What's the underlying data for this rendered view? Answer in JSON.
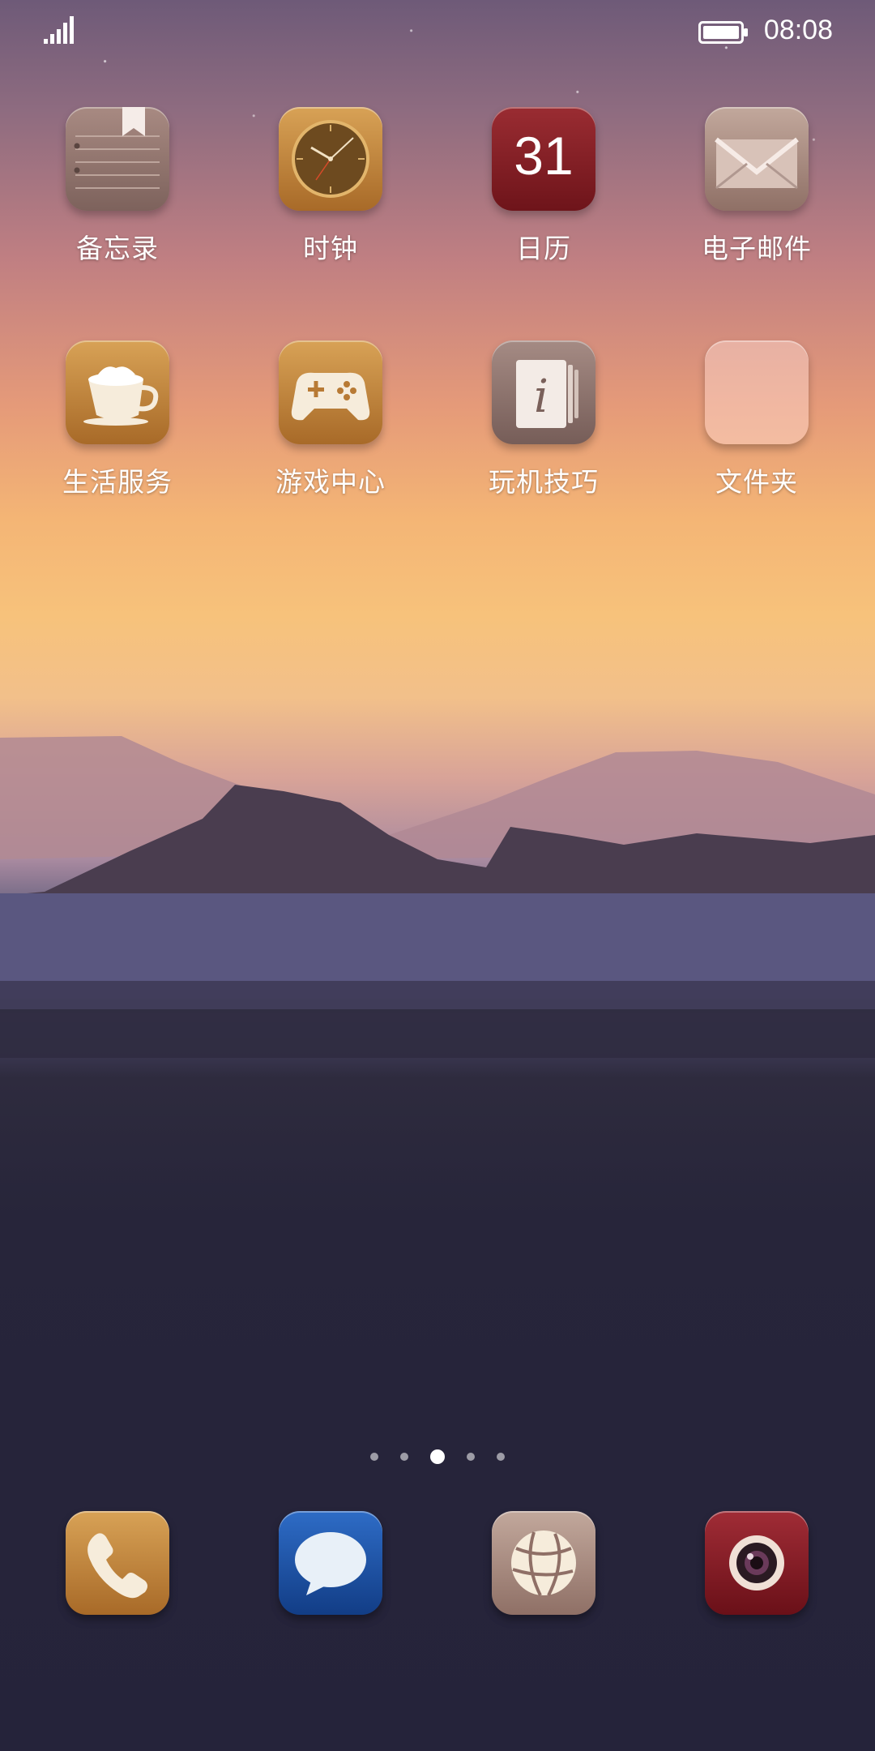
{
  "status_bar": {
    "time": "08:08",
    "signal_icon": "signal-bars-icon",
    "battery_icon": "battery-full-icon"
  },
  "home_apps": [
    {
      "label": "备忘录",
      "icon": "memo-notepad-icon"
    },
    {
      "label": "时钟",
      "icon": "clock-icon"
    },
    {
      "label": "日历",
      "icon": "calendar-icon",
      "badge": "31"
    },
    {
      "label": "电子邮件",
      "icon": "envelope-icon"
    },
    {
      "label": "生活服务",
      "icon": "coffee-cup-icon"
    },
    {
      "label": "游戏中心",
      "icon": "gamepad-icon"
    },
    {
      "label": "玩机技巧",
      "icon": "info-book-icon"
    },
    {
      "label": "文件夹",
      "icon": "folder-icon"
    }
  ],
  "page_indicator": {
    "pages": 5,
    "current_page": 3
  },
  "dock": [
    {
      "name": "phone",
      "icon": "phone-handset-icon"
    },
    {
      "name": "messages",
      "icon": "speech-bubble-icon"
    },
    {
      "name": "browser",
      "icon": "globe-icon"
    },
    {
      "name": "camera",
      "icon": "camera-lens-icon"
    }
  ],
  "colors": {
    "sky_top": "#6e5a78",
    "sky_horizon": "#f7c27b",
    "water": "#5d5a7d",
    "ground": "#25233a"
  }
}
